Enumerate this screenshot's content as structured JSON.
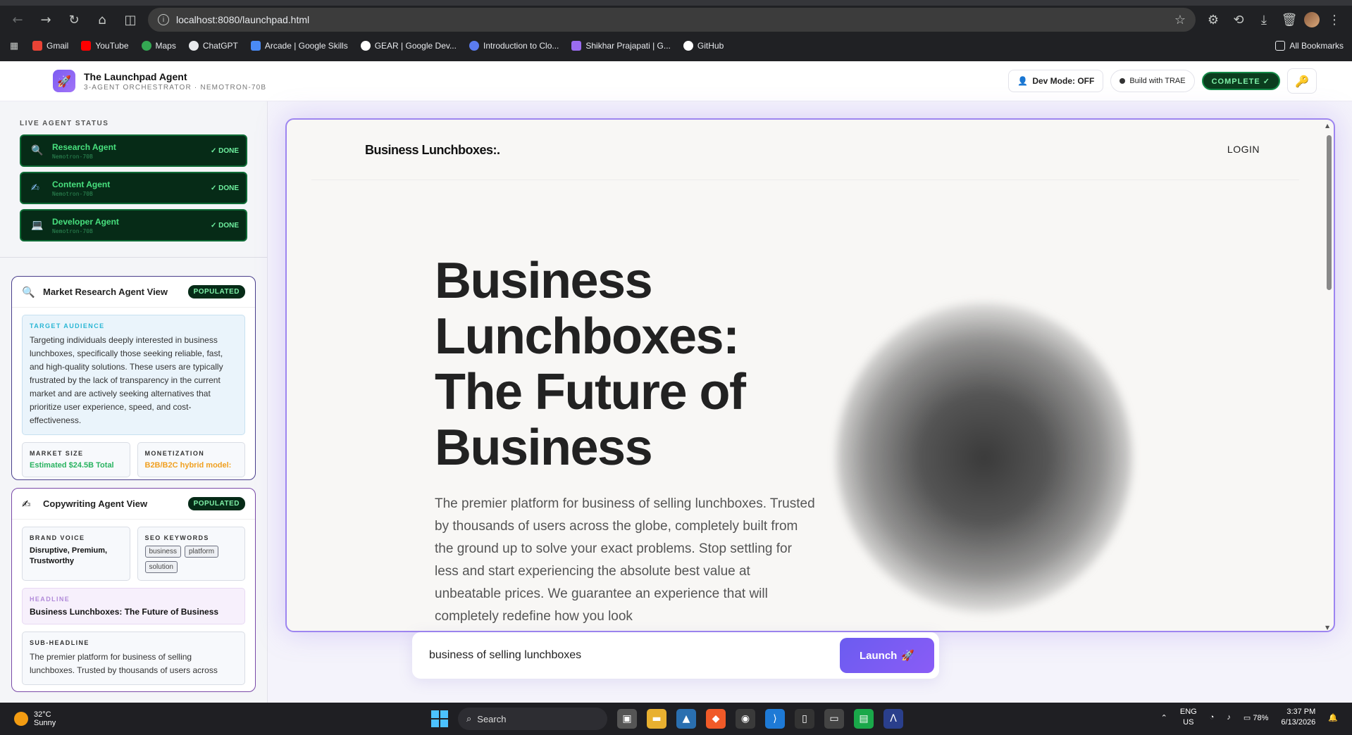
{
  "browser": {
    "url": "localhost:8080/launchpad.html",
    "bookmarks": [
      "Gmail",
      "YouTube",
      "Maps",
      "ChatGPT",
      "Arcade | Google Skills",
      "GEAR | Google Dev...",
      "Introduction to Clo...",
      "Shikhar Prajapati | G...",
      "GitHub"
    ],
    "all_bookmarks": "All Bookmarks"
  },
  "app": {
    "title": "The Launchpad Agent",
    "subtitle": "3-AGENT ORCHESTRATOR · NEMOTRON-70B",
    "dev_mode": "Dev Mode: OFF",
    "build_with": "Build with TRAE",
    "status": "COMPLETE ✓"
  },
  "sidebar": {
    "section_label": "LIVE AGENT STATUS",
    "agents": [
      {
        "name": "Research Agent",
        "model": "Nemotron-70B",
        "status": "✓ DONE"
      },
      {
        "name": "Content Agent",
        "model": "Nemotron-70B",
        "status": "✓ DONE"
      },
      {
        "name": "Developer Agent",
        "model": "Nemotron-70B",
        "status": "✓ DONE"
      }
    ]
  },
  "research_panel": {
    "title": "Market Research Agent View",
    "badge": "POPULATED",
    "target_label": "TARGET AUDIENCE",
    "target_text": "Targeting individuals deeply interested in business lunchboxes, specifically those seeking reliable, fast, and high-quality solutions. These users are typically frustrated by the lack of transparency in the current market and are actively seeking alternatives that prioritize user experience, speed, and cost-effectiveness.",
    "market_size_label": "MARKET SIZE",
    "market_size_value": "Estimated $24.5B Total",
    "monetization_label": "MONETIZATION",
    "monetization_value": "B2B/B2C hybrid model:"
  },
  "copy_panel": {
    "title": "Copywriting Agent View",
    "badge": "POPULATED",
    "brand_voice_label": "BRAND VOICE",
    "brand_voice_value": "Disruptive, Premium, Trustworthy",
    "seo_label": "SEO KEYWORDS",
    "seo_keywords": [
      "business",
      "platform",
      "solution"
    ],
    "headline_label": "HEADLINE",
    "headline_value": "Business Lunchboxes: The Future of Business",
    "subheadline_label": "SUB-HEADLINE",
    "subheadline_value": "The premier platform for business of selling lunchboxes. Trusted by thousands of users across"
  },
  "preview": {
    "logo": "Business Lunchboxes:.",
    "login": "LOGIN",
    "headline": "Business Lunchboxes: The Future of Business",
    "body": "The premier platform for business of selling lunchboxes. Trusted by thousands of users across the globe, completely built from the ground up to solve your exact problems. Stop settling for less and start experiencing the absolute best value at unbeatable prices. We guarantee an experience that will completely redefine how you look"
  },
  "launch": {
    "query": "business of selling lunchboxes",
    "button": "Launch"
  },
  "taskbar": {
    "temp": "32°C",
    "condition": "Sunny",
    "search": "Search",
    "lang": "ENG",
    "region": "US",
    "battery": "78%",
    "time": "3:37 PM",
    "date": "6/13/2026"
  }
}
